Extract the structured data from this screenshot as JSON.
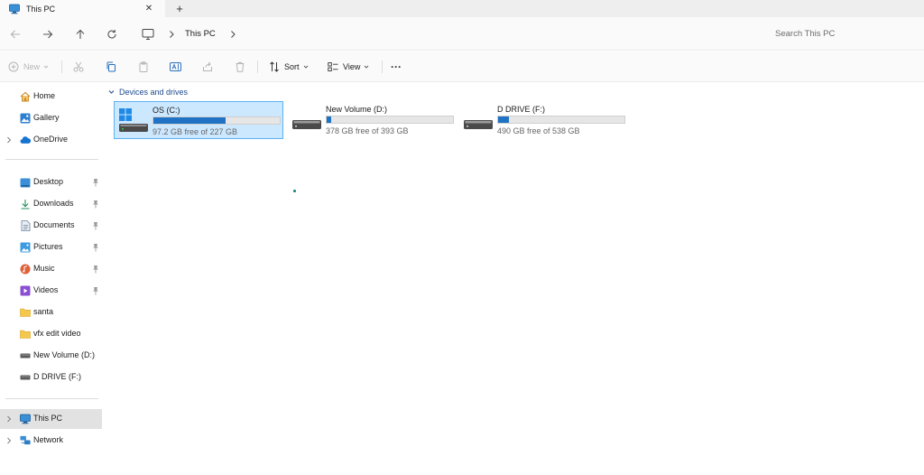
{
  "window": {
    "tab_title": "This PC",
    "tab_icon": "computer-icon",
    "close_tab_glyph": "✕",
    "new_tab_glyph": "+"
  },
  "address_bar": {
    "breadcrumb": [
      "This PC"
    ],
    "search_placeholder": "Search This PC"
  },
  "command_bar": {
    "new_label": "New",
    "sort_label": "Sort",
    "view_label": "View",
    "more_label": "···"
  },
  "sidebar": {
    "top_items": [
      {
        "label": "Home",
        "icon": "home-icon"
      },
      {
        "label": "Gallery",
        "icon": "gallery-icon"
      },
      {
        "label": "OneDrive",
        "icon": "cloud-icon",
        "expandable": true
      }
    ],
    "pinned_items": [
      {
        "label": "Desktop",
        "icon": "desktop-folder-icon",
        "pinned": true
      },
      {
        "label": "Downloads",
        "icon": "download-icon",
        "pinned": true
      },
      {
        "label": "Documents",
        "icon": "documents-icon",
        "pinned": true
      },
      {
        "label": "Pictures",
        "icon": "pictures-icon",
        "pinned": true
      },
      {
        "label": "Music",
        "icon": "music-icon",
        "pinned": true
      },
      {
        "label": "Videos",
        "icon": "videos-icon",
        "pinned": true
      },
      {
        "label": "santa",
        "icon": "folder-icon"
      },
      {
        "label": "vfx edit video",
        "icon": "folder-icon"
      },
      {
        "label": "New Volume (D:)",
        "icon": "drive-icon"
      },
      {
        "label": "D DRIVE  (F:)",
        "icon": "drive-icon"
      }
    ],
    "bottom_items": [
      {
        "label": "This PC",
        "icon": "computer-icon",
        "selected": true
      },
      {
        "label": "Network",
        "icon": "network-icon"
      }
    ]
  },
  "main": {
    "group_label": "Devices and drives",
    "drives": [
      {
        "name": "OS (C:)",
        "free_text": "97.2 GB free of 227 GB",
        "used_fraction": 0.572,
        "selected": true,
        "icon": "windows-drive-icon"
      },
      {
        "name": "New Volume (D:)",
        "free_text": "378 GB free of 393 GB",
        "used_fraction": 0.038,
        "selected": false,
        "icon": "drive-icon"
      },
      {
        "name": "D DRIVE  (F:)",
        "free_text": "490 GB free of 538 GB",
        "used_fraction": 0.089,
        "selected": false,
        "icon": "drive-icon"
      }
    ]
  },
  "colors": {
    "accent": "#1f72c4",
    "selection_bg": "#cce8ff",
    "selection_border": "#5bb1f2",
    "group_header": "#1c4a8d"
  }
}
